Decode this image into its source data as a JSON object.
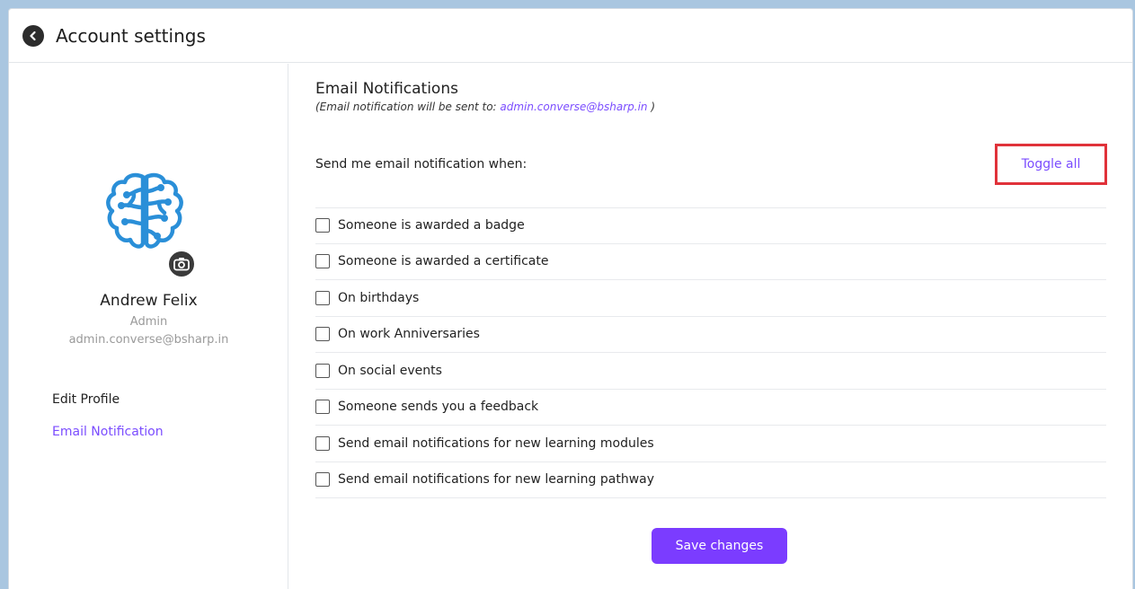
{
  "header": {
    "title": "Account settings",
    "back_icon": "chevron-left-icon"
  },
  "profile": {
    "name": "Andrew Felix",
    "role": "Admin",
    "email": "admin.converse@bsharp.in",
    "avatar_icon": "brain-icon",
    "camera_icon": "camera-icon"
  },
  "sidebar": {
    "items": [
      {
        "label": "Edit Profile",
        "active": false
      },
      {
        "label": "Email Notification",
        "active": true
      }
    ]
  },
  "notifications": {
    "title": "Email Notifications",
    "subtitle_prefix": "(Email notification will be sent to: ",
    "subtitle_email": "admin.converse@bsharp.in",
    "subtitle_suffix": " )",
    "send_when": "Send me email notification when:",
    "toggle_all": "Toggle all",
    "options": [
      {
        "label": "Someone is awarded a badge",
        "checked": false
      },
      {
        "label": "Someone is awarded a certificate",
        "checked": false
      },
      {
        "label": "On birthdays",
        "checked": false
      },
      {
        "label": "On work Anniversaries",
        "checked": false
      },
      {
        "label": "On social events",
        "checked": false
      },
      {
        "label": "Someone sends you a feedback",
        "checked": false
      },
      {
        "label": "Send email notifications for new learning modules",
        "checked": false
      },
      {
        "label": "Send email notifications for new learning pathway",
        "checked": false
      }
    ],
    "save_label": "Save changes"
  },
  "colors": {
    "accent": "#7b3cff",
    "link": "#7b4dff",
    "highlight_border": "#e0323a",
    "avatar_blue": "#2a8fd8"
  }
}
